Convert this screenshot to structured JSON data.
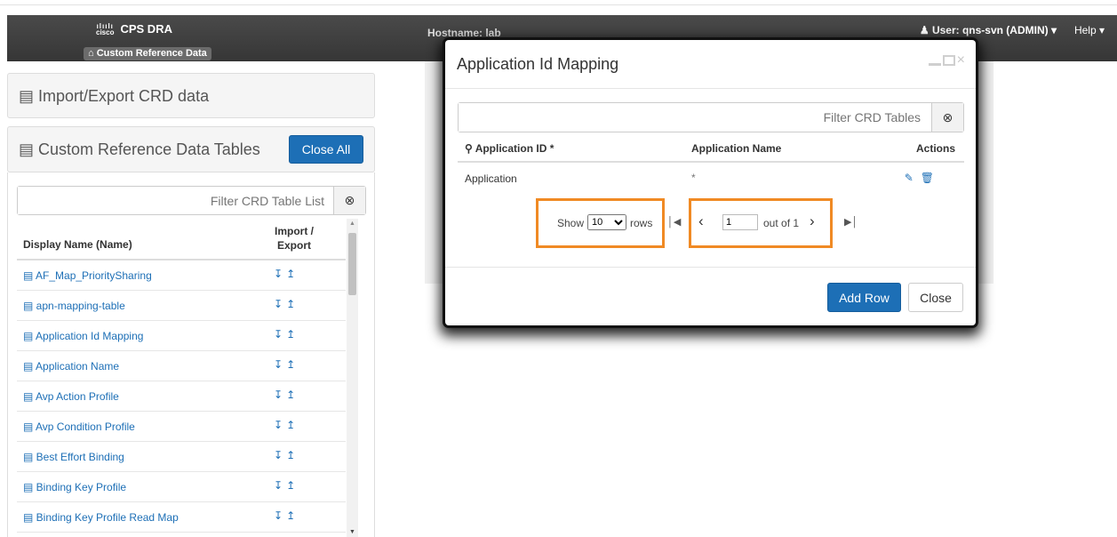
{
  "app": {
    "logo_text": "cisco",
    "title": "CPS DRA",
    "breadcrumb": "Custom Reference Data",
    "hostname": "Hostname: lab",
    "user": "User: qns-svn (ADMIN)",
    "help": "Help"
  },
  "sidebar": {
    "import_export_title": "Import/Export CRD data",
    "crd_tables_title": "Custom Reference Data Tables",
    "close_all_label": "Close All",
    "filter_placeholder": "Filter CRD Table List",
    "col_display_name": "Display Name (Name)",
    "col_import": "Import /",
    "col_export": "Export",
    "items": [
      {
        "label": "AF_Map_PrioritySharing"
      },
      {
        "label": "apn-mapping-table"
      },
      {
        "label": "Application Id Mapping"
      },
      {
        "label": "Application Name"
      },
      {
        "label": "Avp Action Profile"
      },
      {
        "label": "Avp Condition Profile"
      },
      {
        "label": "Best Effort Binding"
      },
      {
        "label": "Binding Key Profile"
      },
      {
        "label": "Binding Key Profile Read Map"
      }
    ]
  },
  "modal": {
    "title": "Application Id Mapping",
    "filter_placeholder": "Filter CRD Tables",
    "columns": [
      "Application ID *",
      "Application Name",
      "Actions"
    ],
    "rows": [
      {
        "application_id": "Application",
        "application_name": "*"
      }
    ],
    "pager": {
      "show": "Show",
      "rows_per_page": "10",
      "rows_label": "rows",
      "page": "1",
      "out_of": "out of 1"
    },
    "add_row_label": "Add Row",
    "close_label": "Close"
  },
  "colors": {
    "primary": "#1d6fb6",
    "highlight": "#f08a24",
    "navbar": "#3d3d3d"
  }
}
